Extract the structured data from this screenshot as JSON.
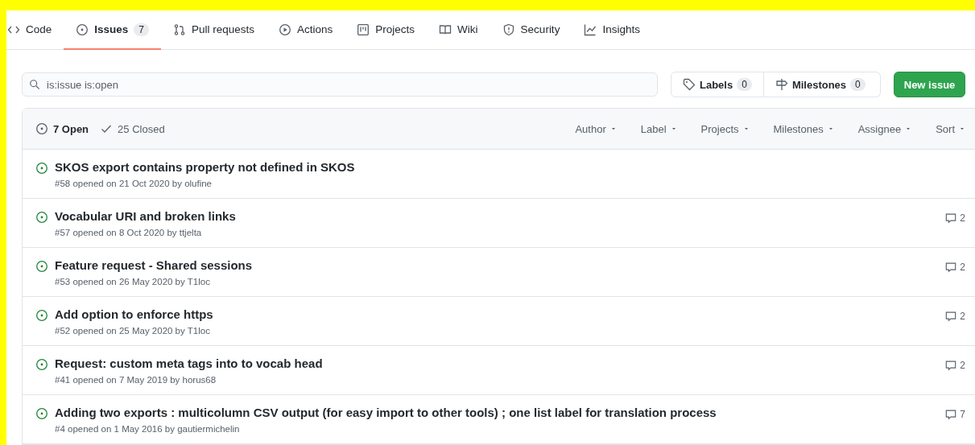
{
  "tabs": [
    {
      "label": "Code",
      "selected": false
    },
    {
      "label": "Issues",
      "count": "7",
      "selected": true
    },
    {
      "label": "Pull requests",
      "selected": false
    },
    {
      "label": "Actions",
      "selected": false
    },
    {
      "label": "Projects",
      "selected": false
    },
    {
      "label": "Wiki",
      "selected": false
    },
    {
      "label": "Security",
      "selected": false
    },
    {
      "label": "Insights",
      "selected": false
    }
  ],
  "search": {
    "value": "is:issue is:open"
  },
  "labels_button": {
    "label": "Labels",
    "count": "0"
  },
  "milestones_button": {
    "label": "Milestones",
    "count": "0"
  },
  "new_issue_button": {
    "label": "New issue"
  },
  "states": [
    {
      "label": "7 Open",
      "selected": true
    },
    {
      "label": "25 Closed",
      "selected": false
    }
  ],
  "filters": [
    "Author",
    "Label",
    "Projects",
    "Milestones",
    "Assignee",
    "Sort"
  ],
  "issues": [
    {
      "title": "SKOS export contains property not defined in SKOS",
      "meta": "#58 opened on 21 Oct 2020 by olufine"
    },
    {
      "title": "Vocabular URI and broken links",
      "meta": "#57 opened on 8 Oct 2020 by ttjelta",
      "comments": "2"
    },
    {
      "title": "Feature request - Shared sessions",
      "meta": "#53 opened on 26 May 2020 by T1loc",
      "comments": "2"
    },
    {
      "title": "Add option to enforce https",
      "meta": "#52 opened on 25 May 2020 by T1loc",
      "comments": "2"
    },
    {
      "title": "Request: custom meta tags into to vocab head",
      "meta": "#41 opened on 7 May 2019 by horus68",
      "comments": "2"
    },
    {
      "title": "Adding two exports : multicolumn CSV output (for easy import to other tools) ; one list label for translation process",
      "meta": "#4 opened on 1 May 2016 by gautiermichelin",
      "comments": "7"
    }
  ]
}
